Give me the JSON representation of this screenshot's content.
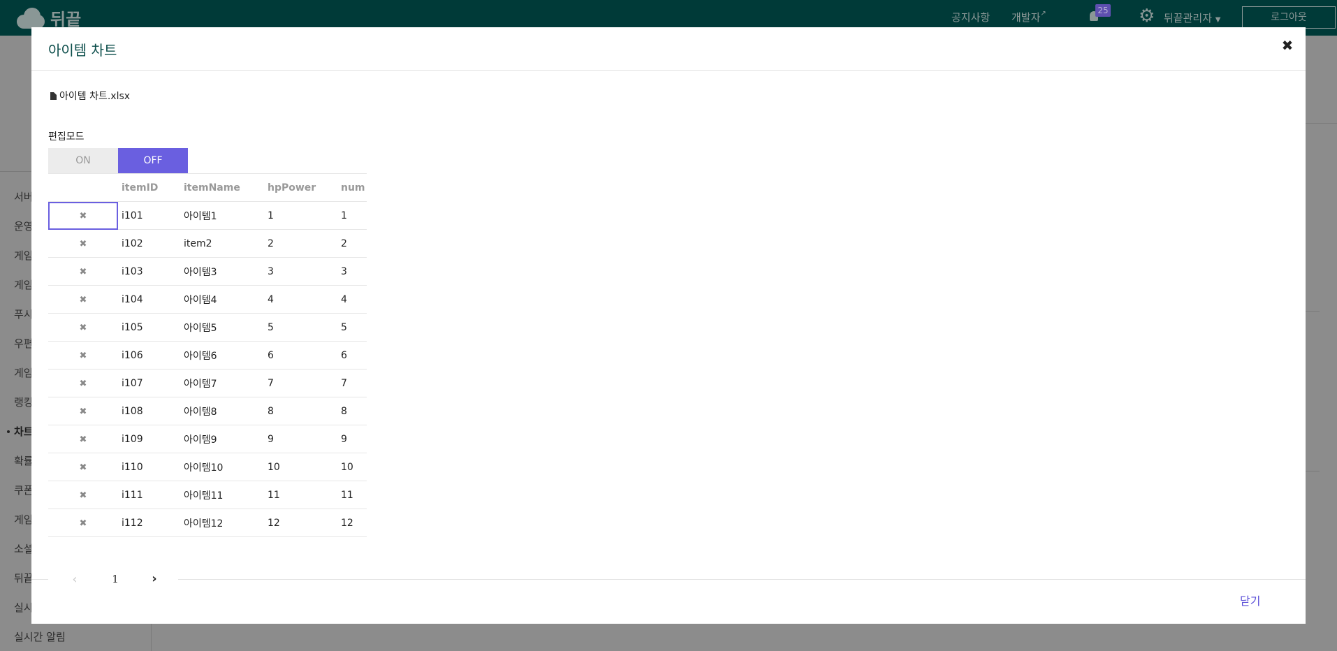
{
  "app": {
    "logo_text": "뒤끝",
    "nav": {
      "notice": "공지사항",
      "developer": "개발자",
      "notification_count": "25",
      "admin": "뒤끝관리자",
      "logout": "로그아웃"
    },
    "sidebar_items": [
      "서버",
      "운영",
      "게임",
      "게임",
      "푸시",
      "우편",
      "게임",
      "랭킹",
      "차트",
      "확률",
      "쿠폰",
      "게임",
      "소셜",
      "뒤끝",
      "실시",
      "실시간 알림"
    ],
    "sidebar_active_index": 8
  },
  "modal": {
    "title": "아이템 차트",
    "file_name": "아이템 차트.xlsx",
    "edit_mode_label": "편집모드",
    "toggle": {
      "on_label": "ON",
      "off_label": "OFF",
      "selected": "OFF"
    },
    "columns": [
      "",
      "itemID",
      "itemName",
      "hpPower",
      "num"
    ],
    "rows": [
      {
        "itemID": "i101",
        "itemName": "아이템1",
        "hpPower": "1",
        "num": "1"
      },
      {
        "itemID": "i102",
        "itemName": "item2",
        "hpPower": "2",
        "num": "2"
      },
      {
        "itemID": "i103",
        "itemName": "아이템3",
        "hpPower": "3",
        "num": "3"
      },
      {
        "itemID": "i104",
        "itemName": "아이템4",
        "hpPower": "4",
        "num": "4"
      },
      {
        "itemID": "i105",
        "itemName": "아이템5",
        "hpPower": "5",
        "num": "5"
      },
      {
        "itemID": "i106",
        "itemName": "아이템6",
        "hpPower": "6",
        "num": "6"
      },
      {
        "itemID": "i107",
        "itemName": "아이템7",
        "hpPower": "7",
        "num": "7"
      },
      {
        "itemID": "i108",
        "itemName": "아이템8",
        "hpPower": "8",
        "num": "8"
      },
      {
        "itemID": "i109",
        "itemName": "아이템9",
        "hpPower": "9",
        "num": "9"
      },
      {
        "itemID": "i110",
        "itemName": "아이템10",
        "hpPower": "10",
        "num": "10"
      },
      {
        "itemID": "i111",
        "itemName": "아이템11",
        "hpPower": "11",
        "num": "11"
      },
      {
        "itemID": "i112",
        "itemName": "아이템12",
        "hpPower": "12",
        "num": "12"
      }
    ],
    "delete_glyph": "✖",
    "pagination": {
      "prev": "‹",
      "current_page": "1",
      "next": "›"
    },
    "close_label": "닫기",
    "close_glyph": "✖"
  },
  "colors": {
    "topbar": "#003a38",
    "accent": "#6a5fe0",
    "title_teal": "#0b4d4a",
    "close_text": "#5b4fd8"
  },
  "icons": [
    "file-icon",
    "bell-icon",
    "gear-icon",
    "caret-down-icon",
    "external-link-icon",
    "close-icon",
    "delete-icon",
    "chevron-left-icon",
    "chevron-right-icon"
  ]
}
